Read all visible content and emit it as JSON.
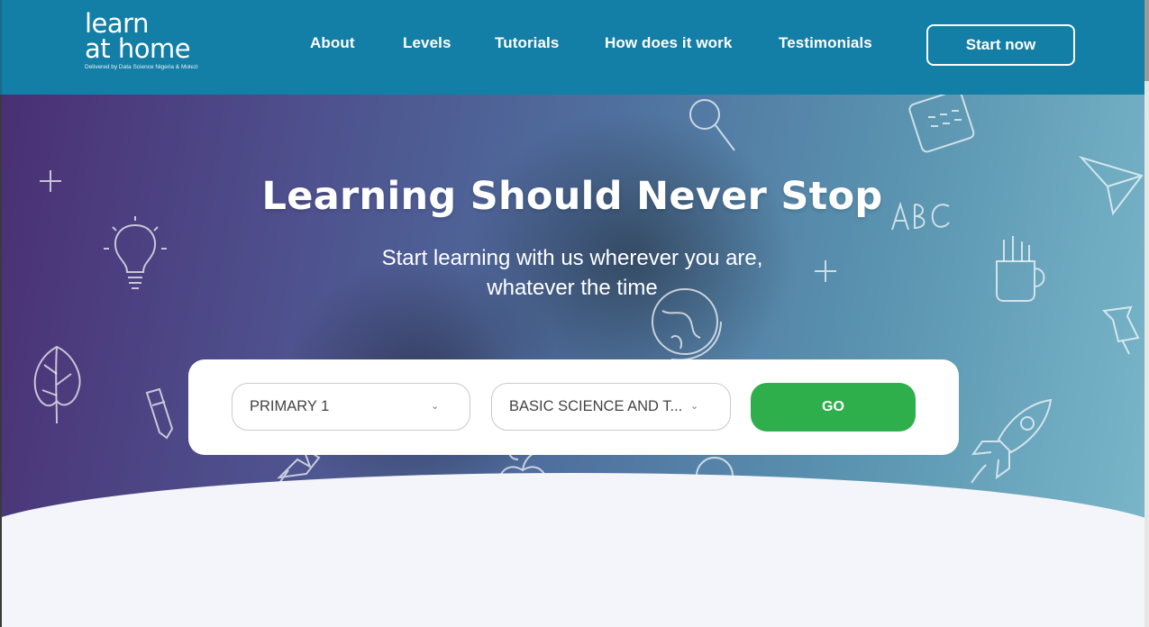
{
  "header": {
    "logo": {
      "line1": "learn",
      "line2": "at home",
      "tagline": "Delivered by Data Science Nigeria & Molezi"
    },
    "nav": [
      {
        "label": "About"
      },
      {
        "label": "Levels"
      },
      {
        "label": "Tutorials"
      },
      {
        "label": "How does it work"
      },
      {
        "label": "Testimonials"
      }
    ],
    "cta_label": "Start now"
  },
  "hero": {
    "title": "Learning Should Never Stop",
    "subtitle_line1": "Start learning with us wherever you are,",
    "subtitle_line2": "whatever the time"
  },
  "search": {
    "level_select": {
      "selected": "PRIMARY 1"
    },
    "subject_select": {
      "selected": "BASIC SCIENCE AND T..."
    },
    "go_label": "GO"
  },
  "colors": {
    "header_bg": "#137ea6",
    "go_button": "#2eaf4b",
    "page_bg": "#f4f5fa"
  },
  "icons": {
    "select_chevron": "chevron-down-icon"
  }
}
